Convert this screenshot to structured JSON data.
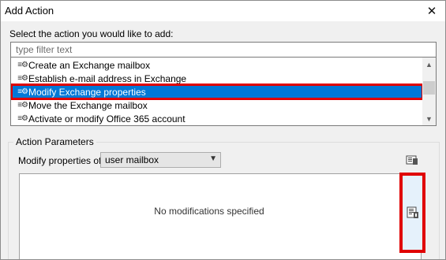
{
  "window": {
    "title": "Add Action"
  },
  "prompt": "Select the action you would like to add:",
  "filter": {
    "placeholder": "type filter text",
    "value": ""
  },
  "actions": [
    {
      "label": "Create an Exchange mailbox",
      "icon": "gear-icon",
      "selected": false
    },
    {
      "label": "Establish e-mail address in Exchange",
      "icon": "gear-icon",
      "selected": false
    },
    {
      "label": "Modify Exchange properties",
      "icon": "gear-icon",
      "selected": true
    },
    {
      "label": "Move the Exchange mailbox",
      "icon": "gear-icon",
      "selected": false
    },
    {
      "label": "Activate or modify Office 365 account",
      "icon": "gear-icon",
      "selected": false
    }
  ],
  "params": {
    "group_title": "Action Parameters",
    "modify_label": "Modify properties of",
    "target_value": "user mailbox",
    "empty_text": "No modifications specified"
  },
  "colors": {
    "selection": "#0078d7",
    "highlight": "#e00000"
  }
}
